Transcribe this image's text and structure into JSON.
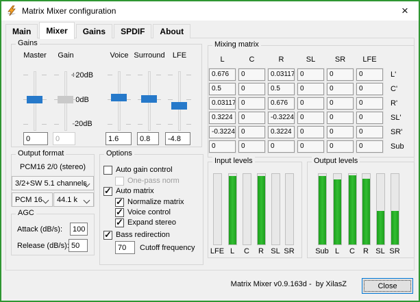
{
  "window": {
    "title": "Matrix Mixer configuration",
    "close_glyph": "×"
  },
  "tabs": [
    {
      "label": "Main"
    },
    {
      "label": "Mixer"
    },
    {
      "label": "Gains"
    },
    {
      "label": "SPDIF"
    },
    {
      "label": "About"
    }
  ],
  "selected_tab": "Mixer",
  "gains": {
    "title": "Gains",
    "scale": [
      "+20dB",
      "0dB",
      "-20dB"
    ],
    "sliders": [
      {
        "label": "Master",
        "value": "0",
        "db": 0,
        "disabled": false
      },
      {
        "label": "Gain",
        "value": "0",
        "db": 0,
        "disabled": true
      },
      {
        "label": "Voice",
        "value": "1.6",
        "db": 1.6,
        "disabled": false
      },
      {
        "label": "Surround",
        "value": "0.8",
        "db": 0.8,
        "disabled": false
      },
      {
        "label": "LFE",
        "value": "-4.8",
        "db": -4.8,
        "disabled": false
      }
    ]
  },
  "mixing_matrix": {
    "title": "Mixing matrix",
    "columns": [
      "L",
      "C",
      "R",
      "SL",
      "SR",
      "LFE"
    ],
    "rows": [
      "L'",
      "C'",
      "R'",
      "SL'",
      "SR'",
      "Sub"
    ],
    "cells": [
      [
        "0.676",
        "0",
        "0.03117",
        "0",
        "0",
        "0"
      ],
      [
        "0.5",
        "0",
        "0.5",
        "0",
        "0",
        "0"
      ],
      [
        "0.03117",
        "0",
        "0.676",
        "0",
        "0",
        "0"
      ],
      [
        "0.3224",
        "0",
        "-0.3224",
        "0",
        "0",
        "0"
      ],
      [
        "-0.3224",
        "0",
        "0.3224",
        "0",
        "0",
        "0"
      ],
      [
        "0",
        "0",
        "0",
        "0",
        "0",
        "0"
      ]
    ]
  },
  "output_format": {
    "title": "Output format",
    "current_format": "PCM16 2/0 (stereo)",
    "speaker_layout": "3/2+SW 5.1 channels",
    "sample_format": "PCM 16",
    "sample_rate": "44.1 k"
  },
  "agc": {
    "title": "AGC",
    "attack_label": "Attack (dB/s):",
    "attack_value": "100",
    "release_label": "Release (dB/s):",
    "release_value": "50"
  },
  "options": {
    "title": "Options",
    "items": [
      {
        "label": "Auto gain control",
        "checked": false,
        "disabled": false
      },
      {
        "label": "One-pass norm",
        "checked": false,
        "disabled": true
      },
      {
        "label": "Auto matrix",
        "checked": true,
        "disabled": false
      },
      {
        "label": "Normalize matrix",
        "checked": true,
        "disabled": false
      },
      {
        "label": "Voice control",
        "checked": true,
        "disabled": false
      },
      {
        "label": "Expand stereo",
        "checked": true,
        "disabled": false
      },
      {
        "label": "Bass redirection",
        "checked": true,
        "disabled": false
      }
    ],
    "cutoff_value": "70",
    "cutoff_label": "Cutoff frequency"
  },
  "input_levels": {
    "title": "Input levels",
    "bars": [
      {
        "label": "LFE",
        "level": 0
      },
      {
        "label": "L",
        "level": 0.97
      },
      {
        "label": "C",
        "level": 0
      },
      {
        "label": "R",
        "level": 0.97
      },
      {
        "label": "SL",
        "level": 0
      },
      {
        "label": "SR",
        "level": 0
      }
    ]
  },
  "output_levels": {
    "title": "Output levels",
    "bars": [
      {
        "label": "Sub",
        "level": 0.97
      },
      {
        "label": "L",
        "level": 0.92
      },
      {
        "label": "C",
        "level": 0.98
      },
      {
        "label": "R",
        "level": 0.93
      },
      {
        "label": "SL",
        "level": 0.48
      },
      {
        "label": "SR",
        "level": 0.48
      }
    ]
  },
  "footer": {
    "version": "Matrix Mixer v0.9.163d -  by XilasZ",
    "close_label": "Close"
  },
  "colors": {
    "window_border": "#2f9632",
    "titlebar_bg": "#ffffff",
    "dialog_bg": "#f0f0f0",
    "slider_thumb_blue": "#2679ca",
    "meter_green": "#1fa71f",
    "focus_border_blue": "#0078d7"
  }
}
